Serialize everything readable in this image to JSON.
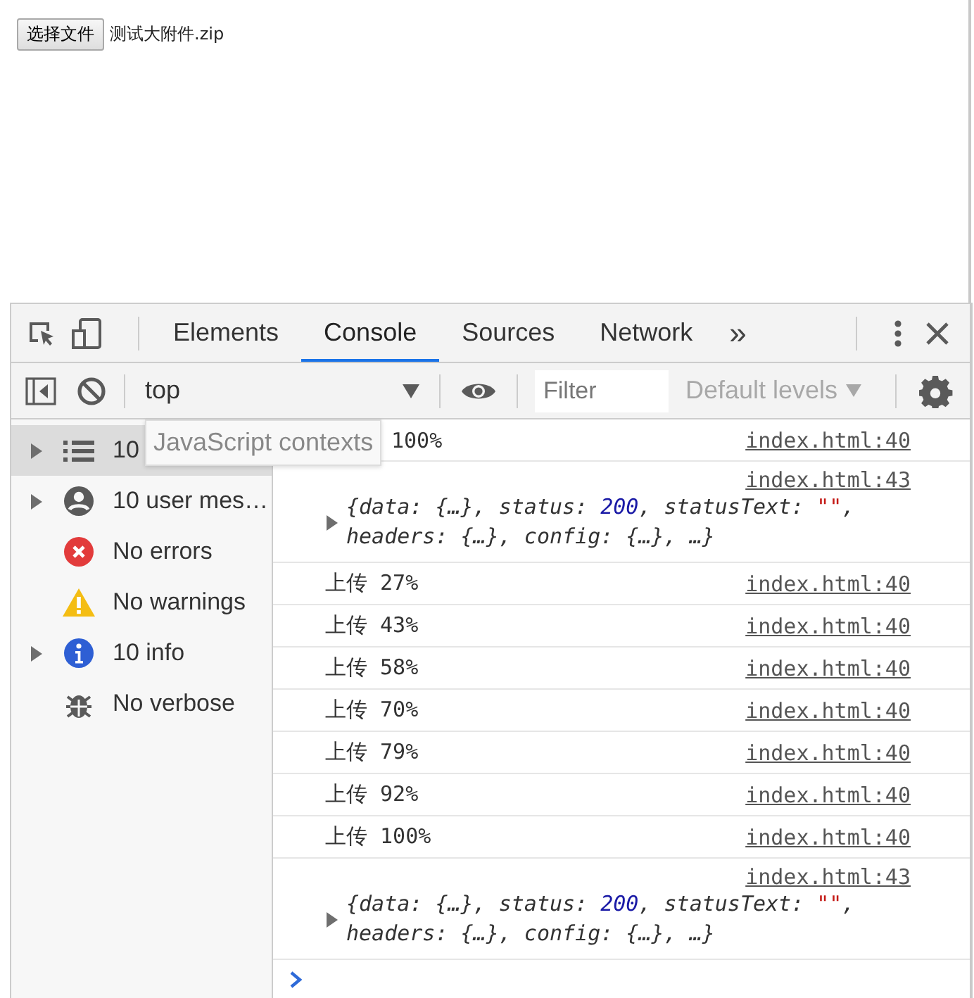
{
  "page": {
    "file_button": "选择文件",
    "file_name": "测试大附件.zip"
  },
  "devtools": {
    "tabs": [
      {
        "label": "Elements",
        "selected": false
      },
      {
        "label": "Console",
        "selected": true
      },
      {
        "label": "Sources",
        "selected": false
      },
      {
        "label": "Network",
        "selected": false
      }
    ],
    "more_tabs": "»",
    "toolbar": {
      "context": "top",
      "filter": {
        "placeholder": "Filter"
      },
      "levels": "Default levels"
    },
    "sidebar": {
      "items": [
        {
          "kind": "messages",
          "label": "10",
          "expandable": true,
          "selected": true
        },
        {
          "kind": "user",
          "label": "10 user mes…",
          "expandable": true,
          "selected": false
        },
        {
          "kind": "error",
          "label": "No errors",
          "expandable": false,
          "selected": false
        },
        {
          "kind": "warning",
          "label": "No warnings",
          "expandable": false,
          "selected": false
        },
        {
          "kind": "info",
          "label": "10 info",
          "expandable": true,
          "selected": false
        },
        {
          "kind": "verbose",
          "label": "No verbose",
          "expandable": false,
          "selected": false
        }
      ]
    },
    "tooltip": "JavaScript contexts",
    "logs": [
      {
        "kind": "text_under_tooltip",
        "text": "100%",
        "source": "index.html:40"
      },
      {
        "kind": "object",
        "source": "index.html:43",
        "lines": [
          [
            {
              "kind": "plain",
              "text": "{data: {…}, status: "
            },
            {
              "kind": "number",
              "text": "200"
            },
            {
              "kind": "plain",
              "text": ", statusText: "
            },
            {
              "kind": "string",
              "text": "\"\""
            },
            {
              "kind": "plain",
              "text": ","
            }
          ],
          [
            {
              "kind": "plain",
              "text": "headers: {…}, config: {…}, …}"
            }
          ]
        ]
      },
      {
        "kind": "text",
        "text": "上传 27%",
        "source": "index.html:40"
      },
      {
        "kind": "text",
        "text": "上传 43%",
        "source": "index.html:40"
      },
      {
        "kind": "text",
        "text": "上传 58%",
        "source": "index.html:40"
      },
      {
        "kind": "text",
        "text": "上传 70%",
        "source": "index.html:40"
      },
      {
        "kind": "text",
        "text": "上传 79%",
        "source": "index.html:40"
      },
      {
        "kind": "text",
        "text": "上传 92%",
        "source": "index.html:40"
      },
      {
        "kind": "text",
        "text": "上传 100%",
        "source": "index.html:40"
      },
      {
        "kind": "object",
        "source": "index.html:43",
        "lines": [
          [
            {
              "kind": "plain",
              "text": "{data: {…}, status: "
            },
            {
              "kind": "number",
              "text": "200"
            },
            {
              "kind": "plain",
              "text": ", statusText: "
            },
            {
              "kind": "string",
              "text": "\"\""
            },
            {
              "kind": "plain",
              "text": ","
            }
          ],
          [
            {
              "kind": "plain",
              "text": "headers: {…}, config: {…}, …}"
            }
          ]
        ]
      }
    ]
  }
}
